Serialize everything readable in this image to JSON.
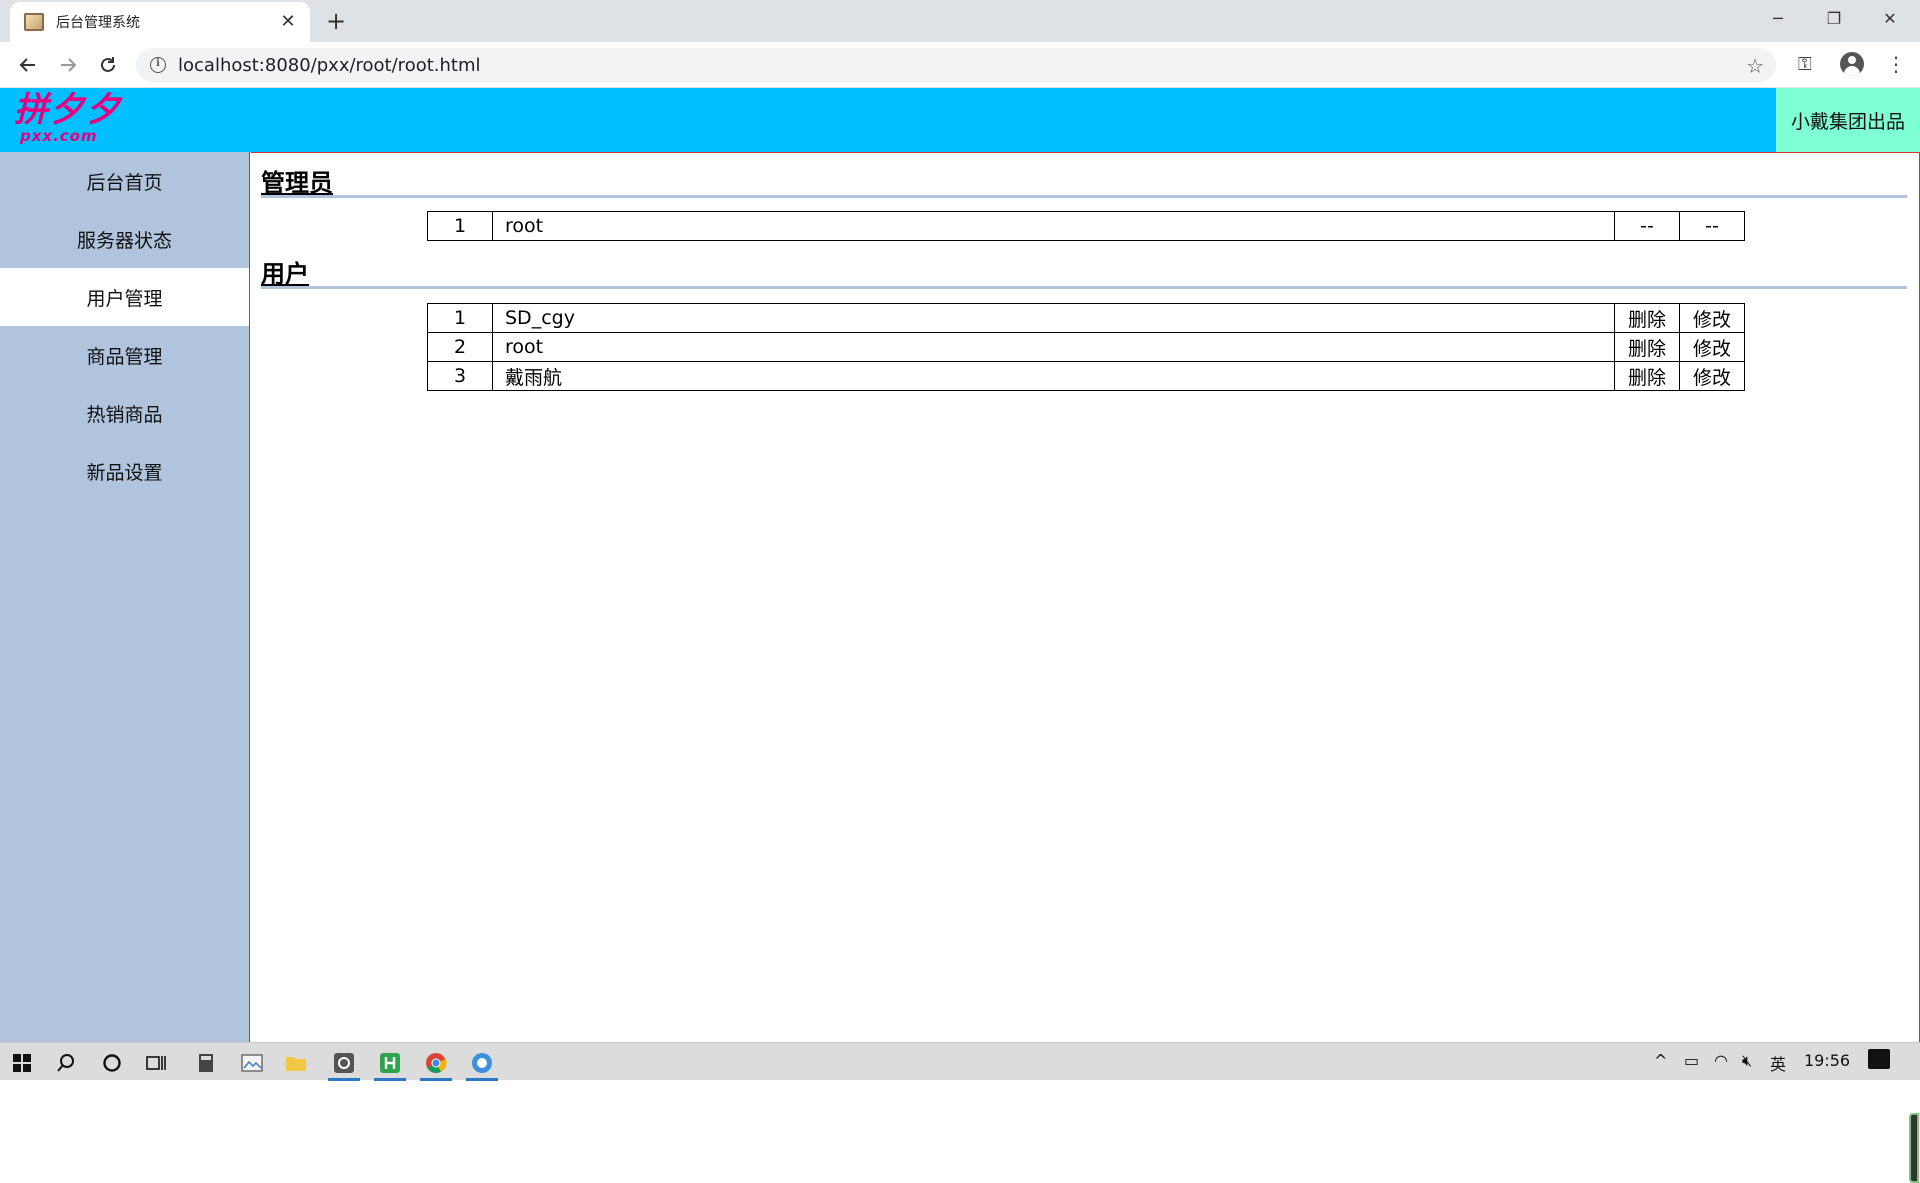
{
  "browser": {
    "tab_title": "后台管理系统",
    "tab_close": "✕",
    "new_tab": "+",
    "url": "localhost:8080/pxx/root/root.html",
    "win_min": "─",
    "win_max": "❐",
    "win_close": "✕"
  },
  "header": {
    "logo_main": "拼夕夕",
    "logo_sub": "pxx.com",
    "credit": "小戴集团出品"
  },
  "sidebar": {
    "items": [
      {
        "label": "后台首页"
      },
      {
        "label": "服务器状态"
      },
      {
        "label": "用户管理"
      },
      {
        "label": "商品管理"
      },
      {
        "label": "热销商品"
      },
      {
        "label": "新品设置"
      }
    ],
    "active_index": 2
  },
  "admins": {
    "title": "管理员",
    "rows": [
      {
        "num": "1",
        "name": "root",
        "delete": "--",
        "edit": "--"
      }
    ]
  },
  "users": {
    "title": "用户",
    "rows": [
      {
        "num": "1",
        "name": "SD_cgy",
        "delete": "删除",
        "edit": "修改"
      },
      {
        "num": "2",
        "name": "root",
        "delete": "删除",
        "edit": "修改"
      },
      {
        "num": "3",
        "name": "戴雨航",
        "delete": "删除",
        "edit": "修改"
      }
    ]
  },
  "taskbar": {
    "ime": "英",
    "time": "19:56"
  },
  "colors": {
    "header_bg": "#00bfff",
    "sidebar_bg": "#b0c4de",
    "credit_bg": "#7fffd4",
    "logo": "#e6007e"
  }
}
